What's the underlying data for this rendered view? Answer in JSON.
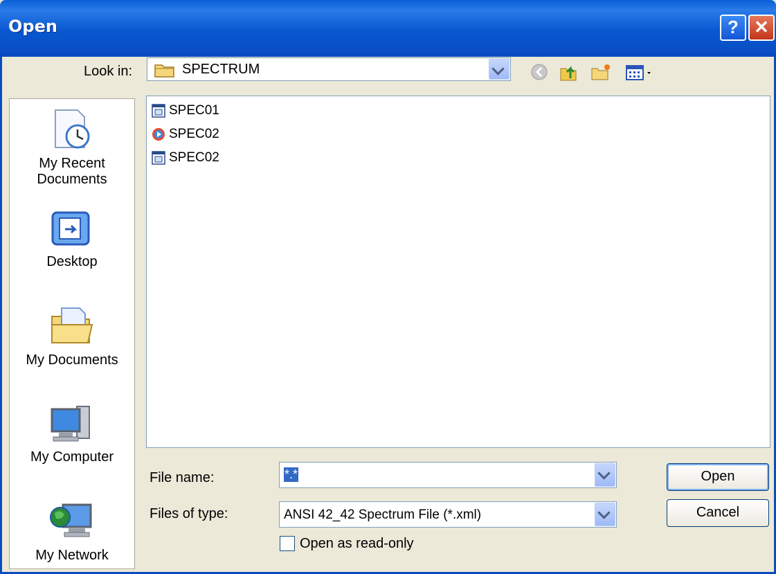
{
  "window": {
    "title": "Open"
  },
  "toolbar": {
    "look_in_label": "Look in:",
    "look_in_value": "SPECTRUM"
  },
  "places": [
    {
      "label_line1": "My Recent",
      "label_line2": "Documents",
      "icon": "recent-documents-icon"
    },
    {
      "label_line1": "Desktop",
      "label_line2": "",
      "icon": "desktop-icon"
    },
    {
      "label_line1": "My Documents",
      "label_line2": "",
      "icon": "my-documents-icon"
    },
    {
      "label_line1": "My Computer",
      "label_line2": "",
      "icon": "my-computer-icon"
    },
    {
      "label_line1": "My Network",
      "label_line2": "",
      "icon": "my-network-icon"
    }
  ],
  "files": [
    {
      "name": "SPEC01",
      "icon": "xml-file-icon"
    },
    {
      "name": "SPEC02",
      "icon": "media-file-icon"
    },
    {
      "name": "SPEC02",
      "icon": "xml-file-icon"
    }
  ],
  "form": {
    "file_name_label": "File name:",
    "file_name_value": "*.*",
    "file_type_label": "Files of type:",
    "file_type_value": "ANSI 42_42 Spectrum File (*.xml)",
    "readonly_label": "Open as read-only"
  },
  "buttons": {
    "open": "Open",
    "cancel": "Cancel",
    "help": "?",
    "close": "✕"
  }
}
